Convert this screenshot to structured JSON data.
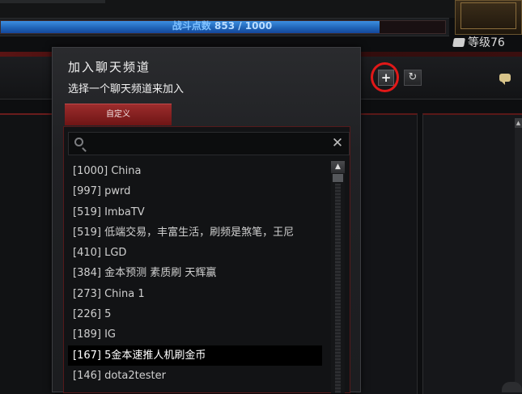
{
  "hud": {
    "battle_points_label": "战斗点数",
    "battle_points_value": "853 / 1000",
    "battle_points_progress": 0.853,
    "level_label": "等级76",
    "level_icon": "card-icon"
  },
  "chat_toolbar": {
    "add_button_icon": "plus-icon",
    "add_button_glyph": "+",
    "refresh_button_icon": "refresh-icon",
    "refresh_button_glyph": "↻",
    "highlight_color": "#e01818"
  },
  "dialog": {
    "title": "加入聊天频道",
    "subtitle": "选择一个聊天频道来加入",
    "tab_label": "自定义",
    "search_placeholder": "",
    "search_value": "",
    "clear_glyph": "✕",
    "channels": [
      "[1000] China",
      "[997] pwrd",
      "[519] ImbaTV",
      "[519] 低端交易，丰富生活，刷频是煞笔，王尼",
      "[410] LGD",
      "[384] 金本预测 素质刷 天辉赢",
      "[273] China 1",
      "[226] 5",
      "[189] IG",
      "[167] 5金本速推人机刷金币",
      "[146] dota2tester"
    ],
    "selected_index": 9,
    "scroll_up_glyph": "▲"
  },
  "colors": {
    "accent_red": "#9c2c2c",
    "progress_blue": "#2a78d0",
    "panel_bg": "#202124"
  }
}
